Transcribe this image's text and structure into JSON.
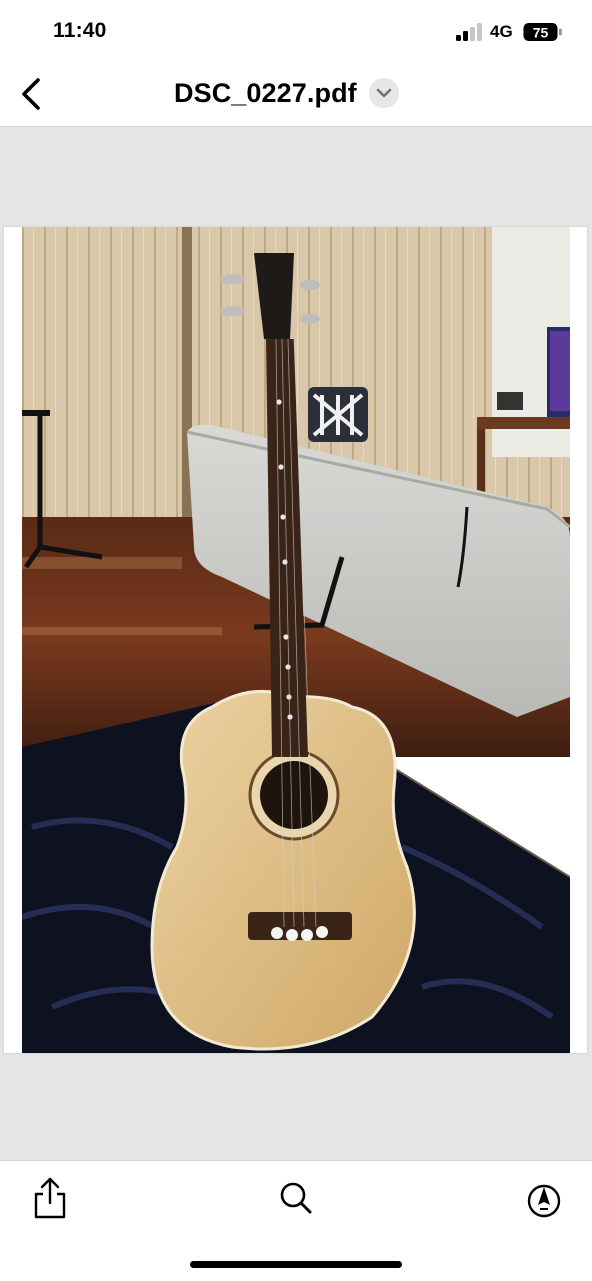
{
  "status_bar": {
    "time": "11:40",
    "network": "4G",
    "battery": "75"
  },
  "nav": {
    "title": "DSC_0227.pdf"
  },
  "document": {
    "pages": 1
  },
  "toolbar": {
    "buttons": [
      "share-icon",
      "search-icon",
      "markup-icon"
    ]
  }
}
